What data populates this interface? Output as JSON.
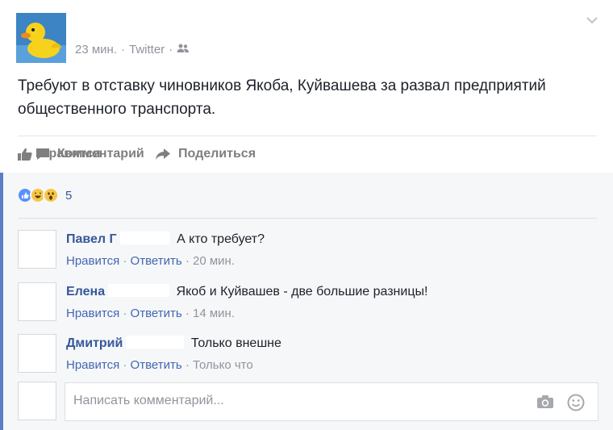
{
  "post": {
    "time": "23 мин.",
    "source": "Twitter",
    "text": "Требуют в отставку чиновников Якоба, Куйвашева за развал предприятий общественного транспорта."
  },
  "actions": {
    "like": "Нравится",
    "comment": "Комментарий",
    "share": "Поделиться"
  },
  "reactions": {
    "icons": [
      "like-icon",
      "haha-icon",
      "wow-icon"
    ],
    "count": "5"
  },
  "comments": [
    {
      "name": "Павел Г",
      "text": "А кто требует?",
      "like": "Нравится",
      "reply": "Ответить",
      "time": "20 мин."
    },
    {
      "name": "Елена",
      "text": "Якоб и Куйвашев - две большие разницы!",
      "like": "Нравится",
      "reply": "Ответить",
      "time": "14 мин."
    },
    {
      "name": "Дмитрий",
      "text": "Только внешне",
      "like": "Нравится",
      "reply": "Ответить",
      "time": "Только что"
    }
  ],
  "compose": {
    "placeholder": "Написать комментарий..."
  },
  "colors": {
    "link": "#365899",
    "muted": "#90949c",
    "accent": "#5b7fc7"
  }
}
